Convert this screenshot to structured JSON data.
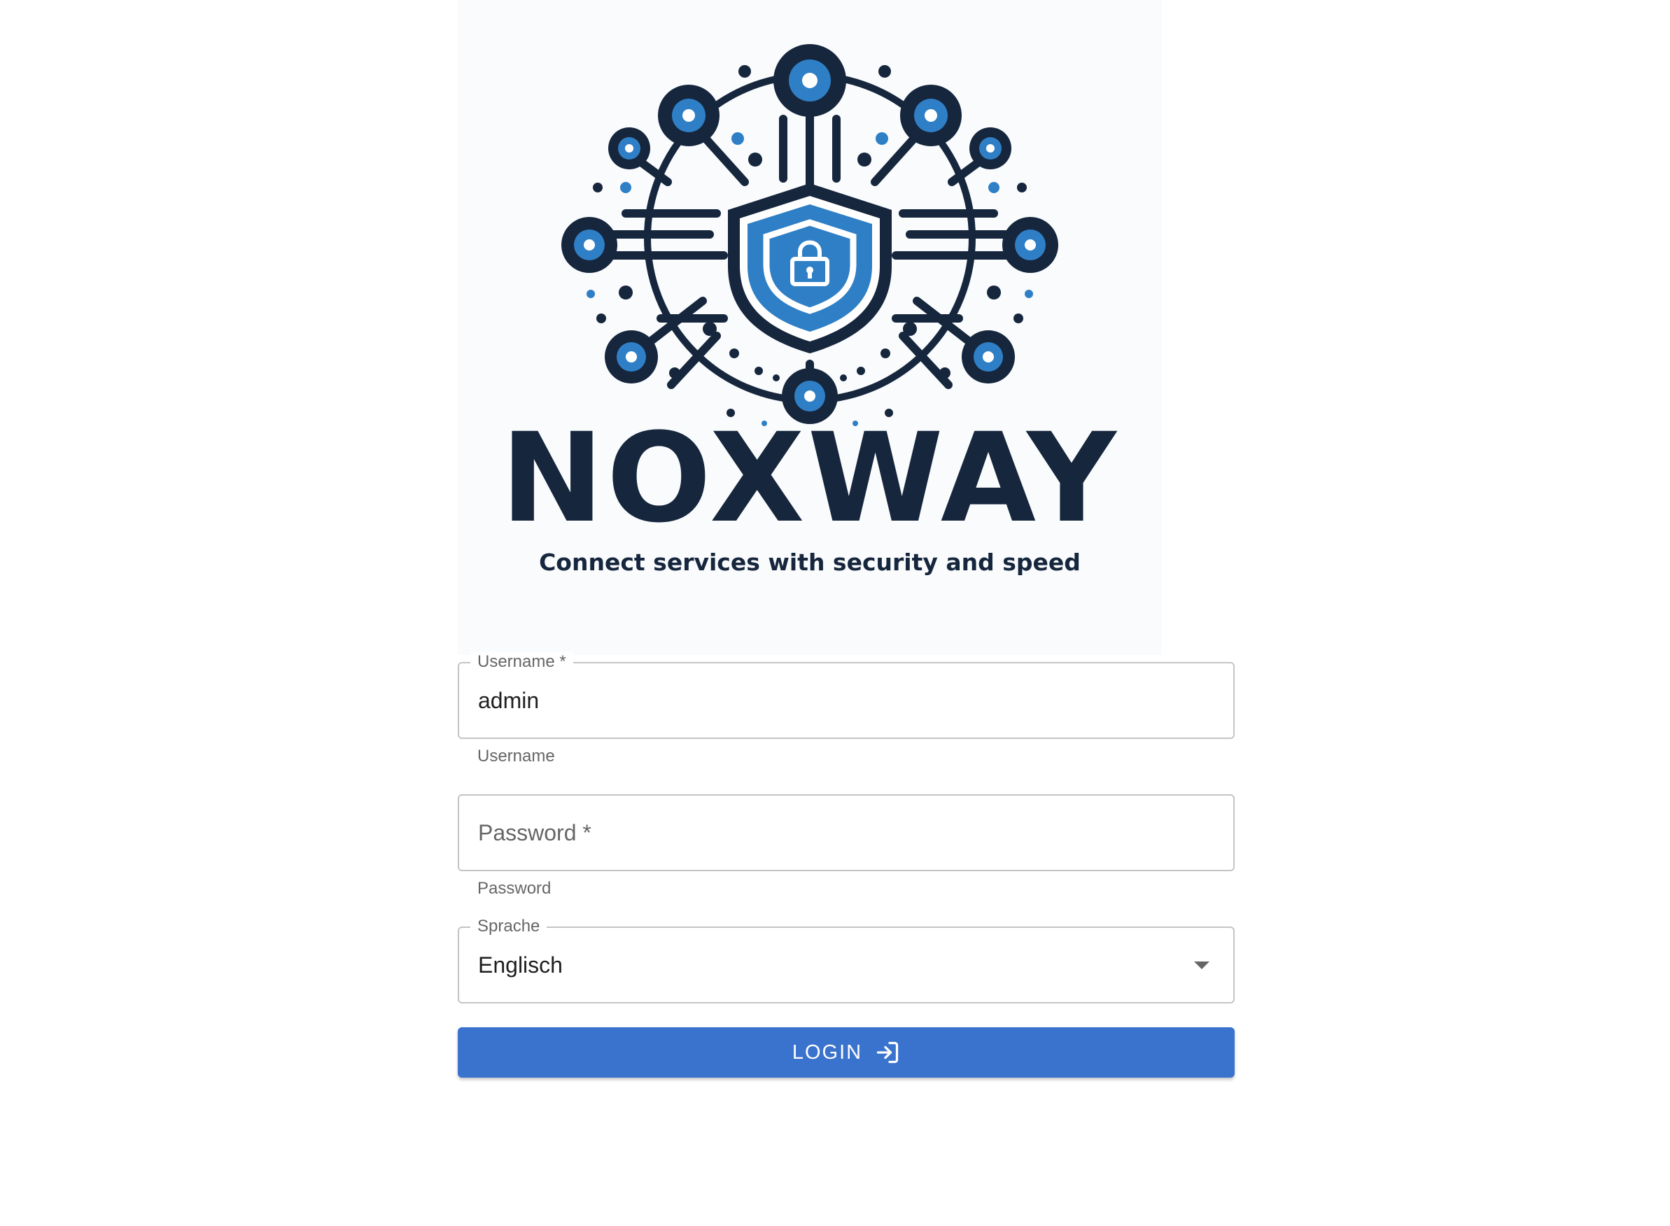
{
  "brand": {
    "name": "NOXWAY",
    "tagline": "Connect services with security and speed"
  },
  "form": {
    "username": {
      "label": "Username",
      "required_marker": "*",
      "value": "admin",
      "helper": "Username"
    },
    "password": {
      "label": "Password",
      "required_marker": "*",
      "value": "",
      "helper": "Password"
    },
    "language": {
      "label": "Sprache",
      "selected": "Englisch"
    },
    "login_button": {
      "label": "LOGIN",
      "icon": "login-icon"
    }
  },
  "colors": {
    "accent": "#3a73cd",
    "brand_dark": "#16263d",
    "logo_blue": "#2f7fc6"
  }
}
